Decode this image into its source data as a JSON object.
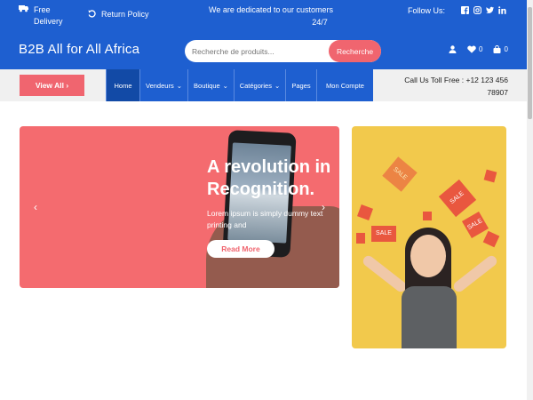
{
  "topbar": {
    "delivery_line1": "Free",
    "delivery_line2": "Delivery",
    "return_policy": "Return Policy",
    "notice_line1": "We are dedicated to our customers",
    "notice_line2": "24/7",
    "follow_label": "Follow Us:",
    "social": [
      "facebook-icon",
      "instagram-icon",
      "twitter-icon",
      "linkedin-icon"
    ]
  },
  "header": {
    "logo": "B2B All for All Africa",
    "search_placeholder": "Recherche de produits...",
    "search_button": "Recherche",
    "wishlist_count": "0",
    "cart_count": "0"
  },
  "nav": {
    "view_all": "View All",
    "items": [
      {
        "label": "Home"
      },
      {
        "label": "Vendeurs"
      },
      {
        "label": "Boutique"
      },
      {
        "label": "Catégories"
      },
      {
        "label": "Pages"
      },
      {
        "label": "Mon Compte"
      }
    ],
    "tollfree_line1": "Call Us Toll Free : +12 123 456",
    "tollfree_line2": "78907"
  },
  "hero": {
    "headline_line1": "A revolution in",
    "headline_line2": "Recognition.",
    "text_line1": "Lorem ipsum is simply dummy text",
    "text_line2": "printing and",
    "button": "Read More",
    "prev": "‹",
    "next": "›"
  },
  "promo": {
    "tag1": "SALE",
    "tag2": "SALE",
    "tag3": "SALE",
    "tag4": "SALE"
  },
  "colors": {
    "brand_blue": "#1e5fd0",
    "accent_coral": "#f0656f",
    "promo_yellow": "#f2c94c"
  }
}
